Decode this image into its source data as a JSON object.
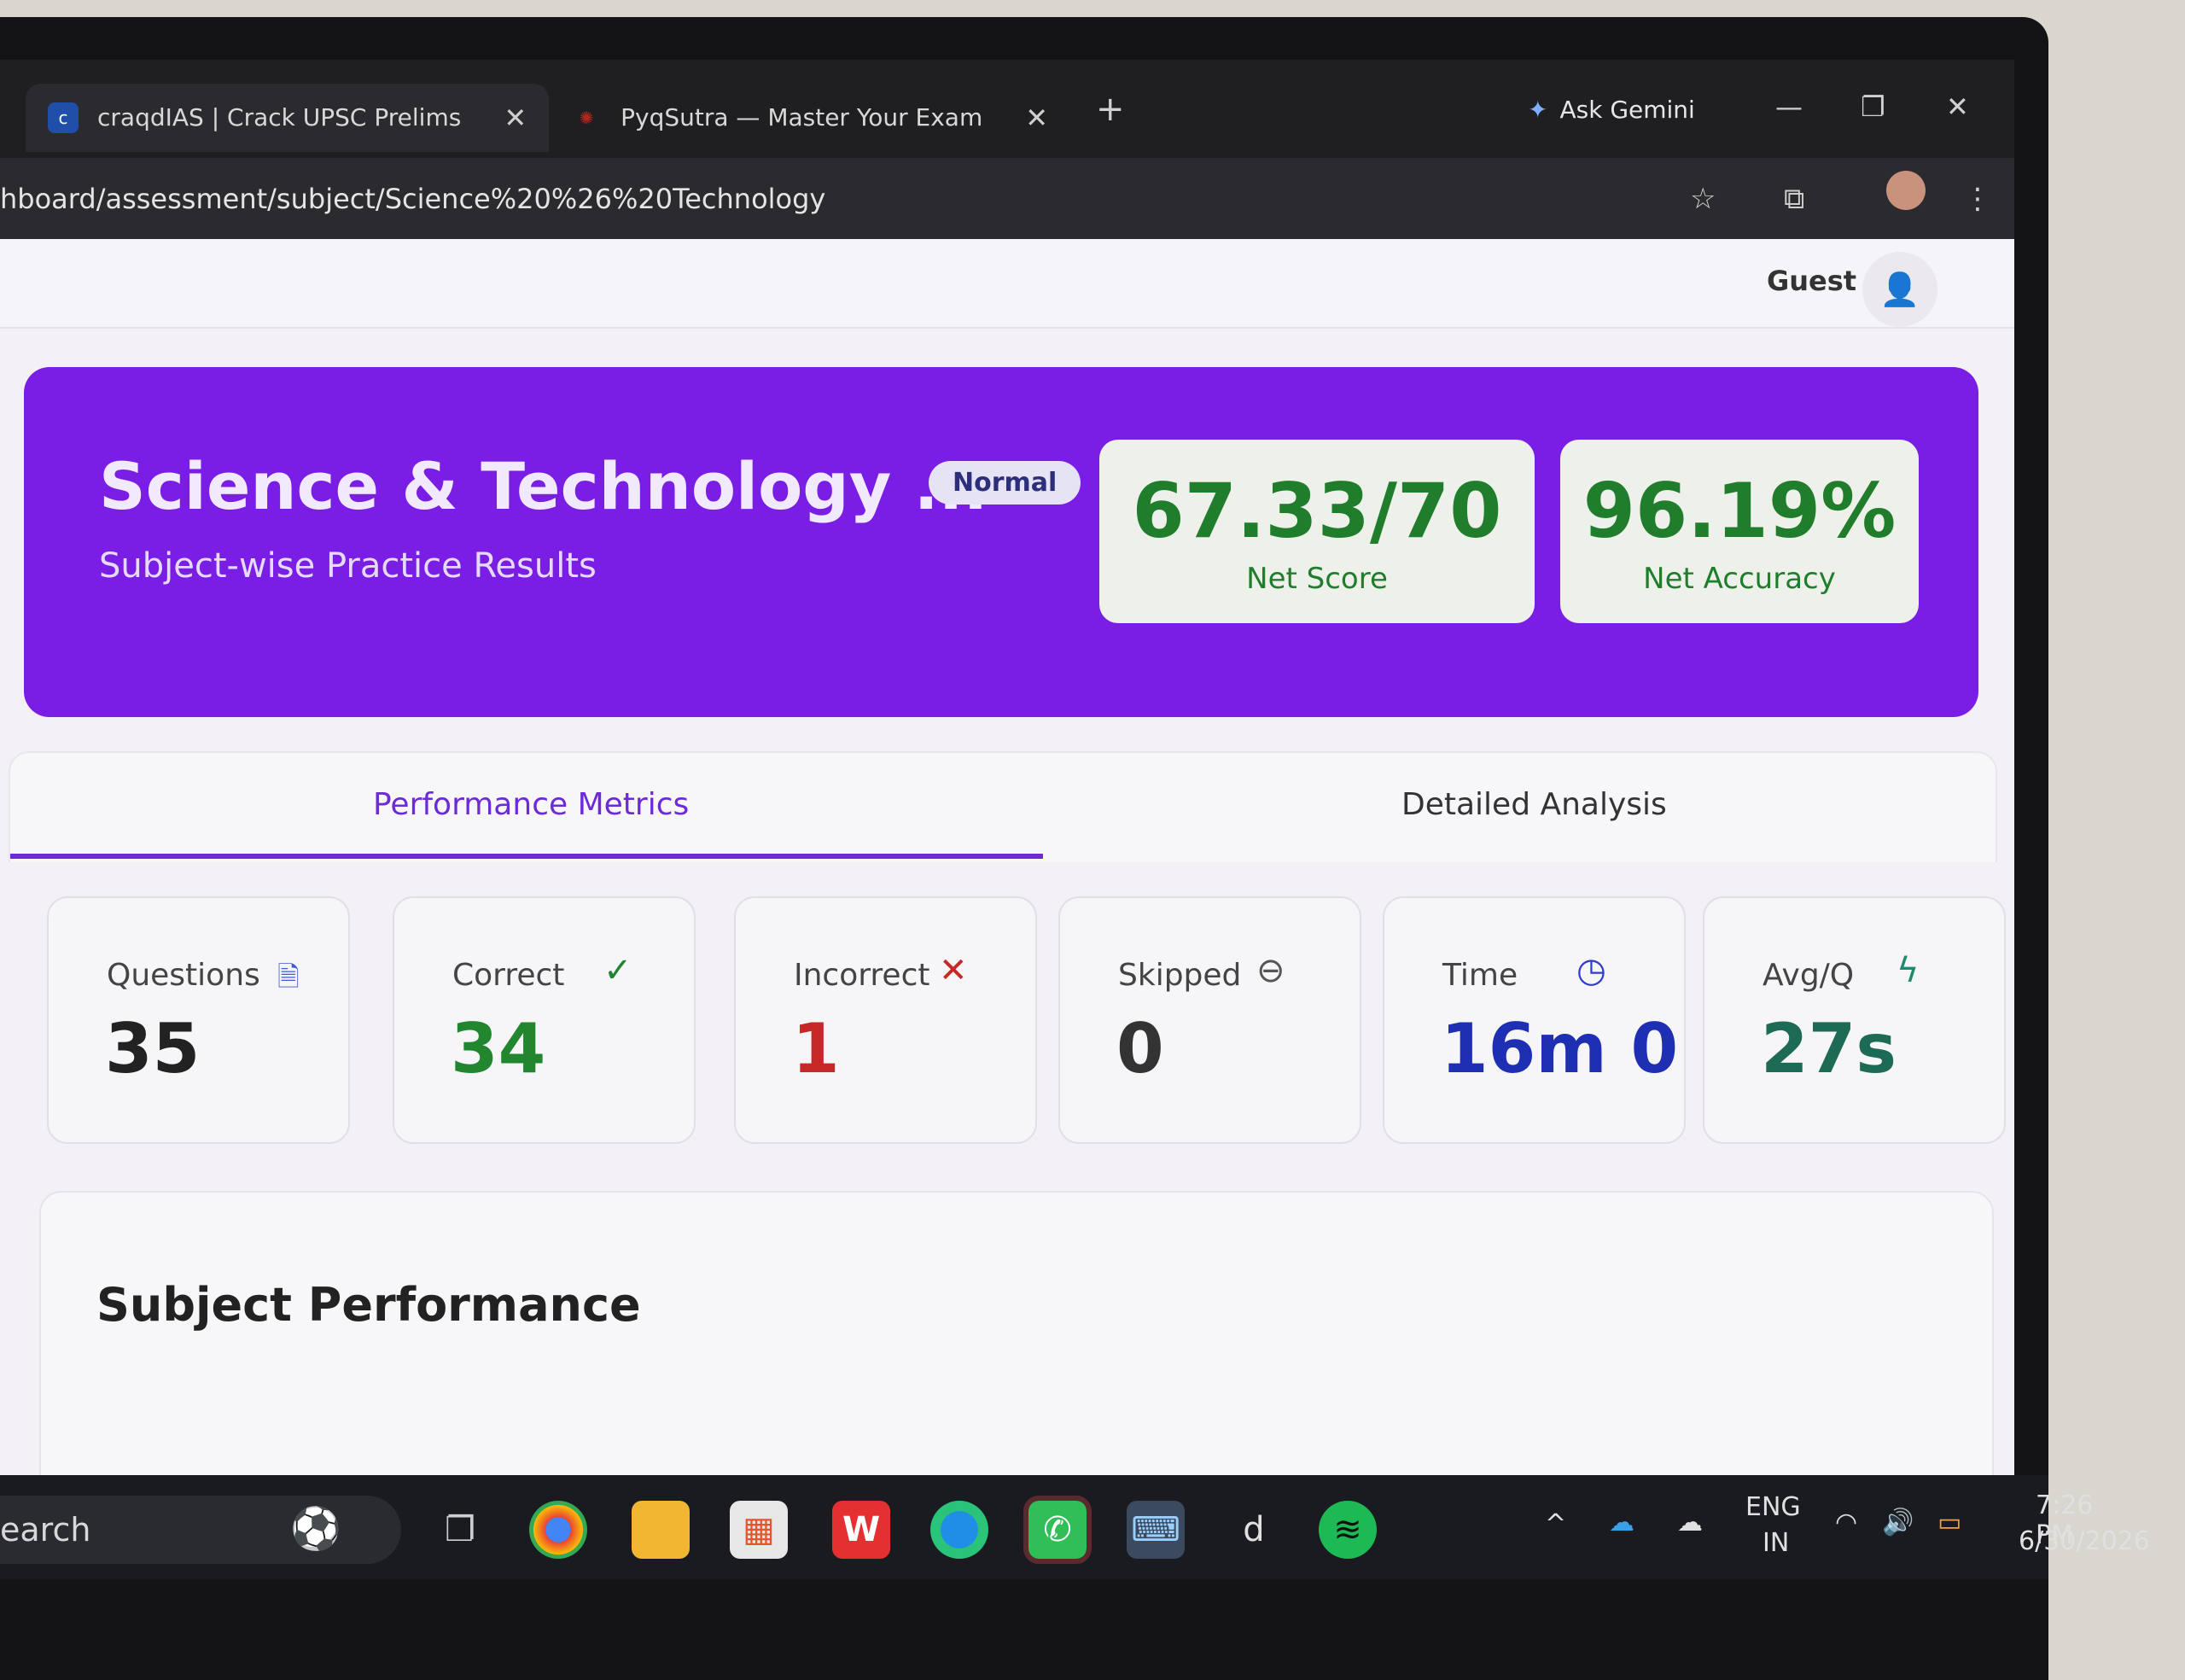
{
  "browser": {
    "tabs": [
      {
        "title": "craqdIAS | Crack UPSC Prelims",
        "favicon_text": "c",
        "favicon_color": "#1f4fa8"
      },
      {
        "title": "PyqSutra — Master Your Exam",
        "favicon_text": "✺",
        "favicon_color": "#b3261e"
      }
    ],
    "new_tab": "+",
    "ask_gemini": "Ask Gemini",
    "url": "hboard/assessment/subject/Science%20%26%20Technology"
  },
  "header": {
    "user_name": "Guest"
  },
  "hero": {
    "title": "Science & Technology ...",
    "subtitle": "Subject-wise Practice Results",
    "badge": "Normal",
    "net_score": {
      "value": "67.33/70",
      "label": "Net Score"
    },
    "net_accuracy": {
      "value": "96.19%",
      "label": "Net Accuracy"
    }
  },
  "tabs": {
    "performance": "Performance Metrics",
    "detailed": "Detailed Analysis"
  },
  "metrics": [
    {
      "label": "Questions",
      "value": "35",
      "icon": "document-icon",
      "color": "#222222"
    },
    {
      "label": "Correct",
      "value": "34",
      "icon": "check-icon",
      "color": "#22862f"
    },
    {
      "label": "Incorrect",
      "value": "1",
      "icon": "cross-icon",
      "color": "#c62828"
    },
    {
      "label": "Skipped",
      "value": "0",
      "icon": "minus-circle-icon",
      "color": "#333333"
    },
    {
      "label": "Time",
      "value": "16m 0",
      "icon": "clock-icon",
      "color": "#1f2fb3"
    },
    {
      "label": "Avg/Q",
      "value": "27s",
      "icon": "lightning-icon",
      "color": "#1d6b55"
    }
  ],
  "subject_section": {
    "title": "Subject Performance"
  },
  "taskbar": {
    "search": "earch",
    "lang": "ENG",
    "region": "IN",
    "time": "7:26 PM",
    "date": "6/30/2026"
  },
  "colors": {
    "hero_bg": "#7a1ee6",
    "accent": "#6c2bd6",
    "score_green": "#1f7d2c"
  }
}
